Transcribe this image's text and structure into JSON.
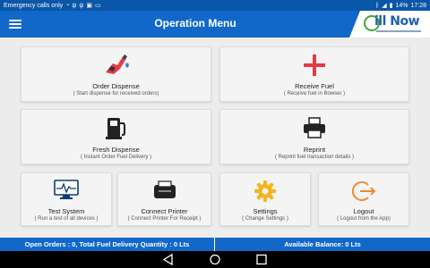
{
  "statusbar": {
    "carrier": "Emergency calls only",
    "battery": "14%",
    "time": "17:28"
  },
  "appbar": {
    "title": "Operation Menu",
    "logo_text": "ill Now"
  },
  "tiles": {
    "order": {
      "title": "Order Dispense",
      "subtitle": "( Start dispense for received orders)"
    },
    "receive": {
      "title": "Receive Fuel",
      "subtitle": "( Receive fuel in Bowser )"
    },
    "fresh": {
      "title": "Fresh Dispense",
      "subtitle": "( Instant Order Fuel Delivery )"
    },
    "reprint": {
      "title": "Reprint",
      "subtitle": "( Reprint fuel transaction details )"
    },
    "test": {
      "title": "Test System",
      "subtitle": "( Run a test of all devices )"
    },
    "printer": {
      "title": "Connect Printer",
      "subtitle": "( Connect Printer For Receipt )"
    },
    "settings": {
      "title": "Settings",
      "subtitle": "( Change Settings )"
    },
    "logout": {
      "title": "Logout",
      "subtitle": "( Logout from the App)"
    }
  },
  "footer": {
    "left": "Open Orders : 0, Total Fuel Delivery Quantity : 0 Lts",
    "right": "Available Balance: 0 Lts"
  },
  "colors": {
    "primary": "#1168c9",
    "status": "#0a56a8",
    "fuel_red": "#e53945",
    "settings_yellow": "#f3b51b",
    "logout_orange": "#f08a2c"
  }
}
